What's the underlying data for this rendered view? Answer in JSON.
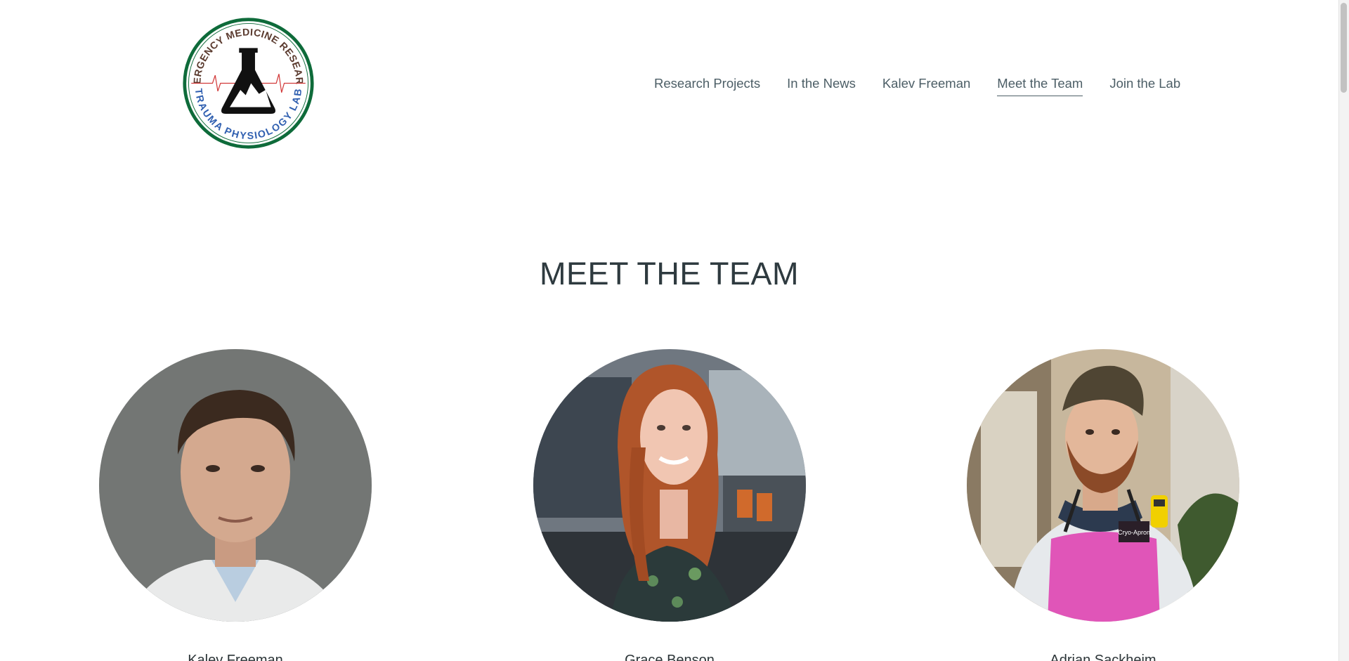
{
  "logo": {
    "top_text": "EMERGENCY MEDICINE RESEARCH",
    "bottom_text": "TRAUMA PHYSIOLOGY LAB",
    "colors": {
      "ring": "#0e6b3a",
      "top_text": "#5a3a2e",
      "bottom_text": "#2f5fb0",
      "ecg": "#d23a3a"
    }
  },
  "nav": {
    "items": [
      {
        "label": "Research Projects"
      },
      {
        "label": "In the News"
      },
      {
        "label": "Kalev Freeman"
      },
      {
        "label": "Meet the Team"
      },
      {
        "label": "Join the Lab"
      }
    ],
    "active": "Meet the Team"
  },
  "page": {
    "title": "MEET THE TEAM"
  },
  "team": [
    {
      "name": "Kalev Freeman"
    },
    {
      "name": "Grace Benson"
    },
    {
      "name": "Adrian Sackheim",
      "apron_text": "Cryo-Apron"
    }
  ]
}
